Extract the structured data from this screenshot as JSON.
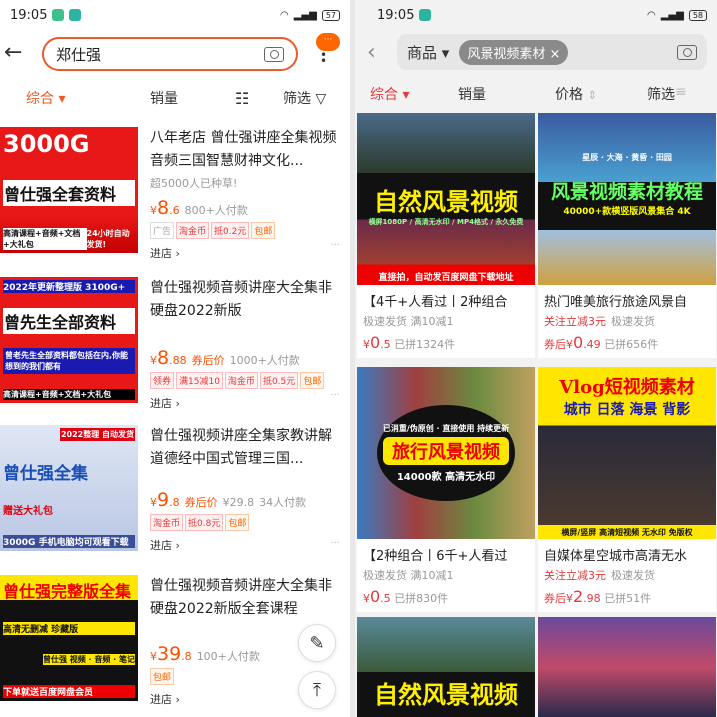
{
  "left": {
    "status": {
      "time": "19:05",
      "battery": "57"
    },
    "search": {
      "query": "郑仕强"
    },
    "more_label": "···",
    "sort": {
      "comprehensive": "综合",
      "sales": "销量",
      "filter": "筛选"
    },
    "items": [
      {
        "title": "八年老店 曾仕强讲座全集视频音频三国智慧财神文化...",
        "sub": "超5000人已种草!",
        "price_int": "8",
        "price_dec": ".6",
        "after": "",
        "orig": "",
        "sold": "800+人付款",
        "tags": [
          {
            "t": "广告",
            "k": "ad"
          },
          {
            "t": "淘金币",
            "k": ""
          },
          {
            "t": "抵0.2元",
            "k": ""
          },
          {
            "t": "包邮",
            "k": "or"
          }
        ],
        "shop": "进店 ›",
        "img": {
          "l1": "3000G",
          "l2": "曾仕强全套资料",
          "l3": "高清课程+音频+文档+大礼包",
          "l4": "24小时自动发货!"
        }
      },
      {
        "title": "曾仕强视频音频讲座大全集非硬盘2022新版",
        "sub": "",
        "price_int": "8",
        "price_dec": ".88",
        "after": "券后价",
        "orig": "",
        "sold": "1000+人付款",
        "tags": [
          {
            "t": "领券",
            "k": ""
          },
          {
            "t": "满15减10",
            "k": ""
          },
          {
            "t": "淘金币",
            "k": ""
          },
          {
            "t": "抵0.5元",
            "k": ""
          },
          {
            "t": "包邮",
            "k": "or"
          }
        ],
        "shop": "进店 ›",
        "img": {
          "l1": "2022年更新整理版 3100G+",
          "l2": "曾先生全部资料",
          "l3": "曾老先生全部资料都包括在内,你能想到的我们都有",
          "l4": "高清课程+音频+文档+大礼包"
        }
      },
      {
        "title": "曾仕强视频讲座全集家教讲解道德经中国式管理三国...",
        "sub": "",
        "price_int": "9",
        "price_dec": ".8",
        "after": "券后价",
        "orig": "¥29.8",
        "sold": "34人付款",
        "tags": [
          {
            "t": "淘金币",
            "k": ""
          },
          {
            "t": "抵0.8元",
            "k": ""
          },
          {
            "t": "包邮",
            "k": "or"
          }
        ],
        "shop": "进店 ›",
        "img": {
          "l1": "2022整理 自动发货",
          "l2": "曾仕强全集",
          "l3": "赠送大礼包",
          "l4": "3000G 手机电脑均可观看下载"
        }
      },
      {
        "title": "曾仕强视频音频讲座大全集非硬盘2022新版全套课程",
        "sub": "",
        "price_int": "39",
        "price_dec": ".8",
        "after": "",
        "orig": "",
        "sold": "100+人付款",
        "tags": [
          {
            "t": "包邮",
            "k": "or"
          }
        ],
        "shop": "进店 ›",
        "img": {
          "l1": "曾仕强完整版全集",
          "l2": "高清无删减 珍藏版",
          "l3": "曾仕强 视频 · 音频 · 笔记",
          "l4": "下单就送百度网盘会员"
        }
      }
    ]
  },
  "right": {
    "status": {
      "time": "19:05",
      "battery": "58"
    },
    "search": {
      "scope": "商品 ▾",
      "chip": "风景视频素材",
      "chip_close": "×"
    },
    "sort": {
      "comprehensive": "综合",
      "sales": "销量",
      "price": "价格",
      "filter": "筛选"
    },
    "cards": [
      {
        "title": "【4千+人看过丨2种组合",
        "m1": "",
        "m2": "极速发货  满10减1",
        "pre": "",
        "int": "0",
        "dec": ".5",
        "sold": "已拼1324件",
        "img": {
          "a": "自然风景视频",
          "b": "横屏1080P / 高清无水印 / MP4格式 / 永久免费",
          "c": "直接拍，自动发百度网盘下载地址"
        }
      },
      {
        "title": "热门唯美旅行旅途风景自",
        "m1": "关注立减3元",
        "m2": "极速发货",
        "pre": "券后",
        "int": "0",
        "dec": ".49",
        "sold": "已拼656件",
        "img": {
          "a": "风景视频素材教程",
          "b": "40000+款横竖版风景集合 4K",
          "c": "星辰 · 大海 · 黄昏 · 田园"
        }
      },
      {
        "title": "【2种组合丨6千+人看过",
        "m1": "",
        "m2": "极速发货  满10减1",
        "pre": "",
        "int": "0",
        "dec": ".5",
        "sold": "已拼830件",
        "img": {
          "a": "旅行风景视频",
          "b": "14000款 高清无水印",
          "c": "已消重/伪原创 · 直接使用 持续更新"
        }
      },
      {
        "title": "自媒体星空城市高清无水",
        "m1": "关注立减3元",
        "m2": "极速发货",
        "pre": "券后",
        "int": "2",
        "dec": ".98",
        "sold": "已拼51件",
        "img": {
          "a": "Vlog短视频素材",
          "b": "城市 日落 海景 背影",
          "c": "横屏/竖屏 高清短视频 无水印 免版权"
        }
      },
      {
        "img": {
          "a": "自然风景视频"
        }
      },
      {
        "img": {
          "a": ""
        }
      }
    ]
  },
  "colors": {
    "accent_left": "#ff5000",
    "accent_right": "#e4393c"
  }
}
